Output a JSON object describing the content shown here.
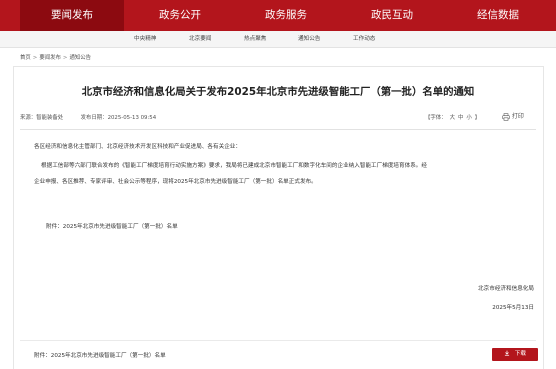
{
  "topnav": {
    "items": [
      "要闻发布",
      "政务公开",
      "政务服务",
      "政民互动",
      "经信数据"
    ]
  },
  "subnav": {
    "items": [
      "中央精神",
      "北京要闻",
      "热点聚焦",
      "通知公告",
      "工作动态"
    ]
  },
  "breadcrumb": {
    "items": [
      "首页",
      "要闻发布",
      "通知公告"
    ],
    "separator": ">"
  },
  "article": {
    "title": "北京市经济和信息化局关于发布2025年北京市先进级智能工厂（第一批）名单的通知",
    "source_label": "来源：",
    "source": "智能装备处",
    "date_label": "发布日期：",
    "date": "2025-05-13 09:54",
    "font_size_label": "【字体：",
    "font_sizes": [
      "大",
      "中",
      "小"
    ],
    "font_size_close": "】",
    "print_label": "打印",
    "salutation": "各区经济和信息化主管部门、北京经济技术开发区科技和产业促进局、各有关企业：",
    "body_line1": "根据工信部等六部门联合发布的《智能工厂梯度培育行动实施方案》要求，我局将已建成北京市智能工厂和数字化车间的企业纳入智能工厂梯度培育体系。经",
    "body_line2": "企业申报、各区推荐、专家评审、社会公示等程序，现将2025年北京市先进级智能工厂（第一批）名单正式发布。",
    "attachment_inline": "附件：2025年北京市先进级智能工厂（第一批）名单",
    "sign_org": "北京市经济和信息化局",
    "sign_date": "2025年5月13日"
  },
  "attachment_bar": {
    "label": "附件：2025年北京市先进级智能工厂（第一批）名单",
    "download_label": "下载"
  },
  "colors": {
    "brand_red": "#b3151c",
    "active_nav": "#8c0a10"
  },
  "icons": {
    "print": "printer-icon",
    "download": "download-icon"
  }
}
